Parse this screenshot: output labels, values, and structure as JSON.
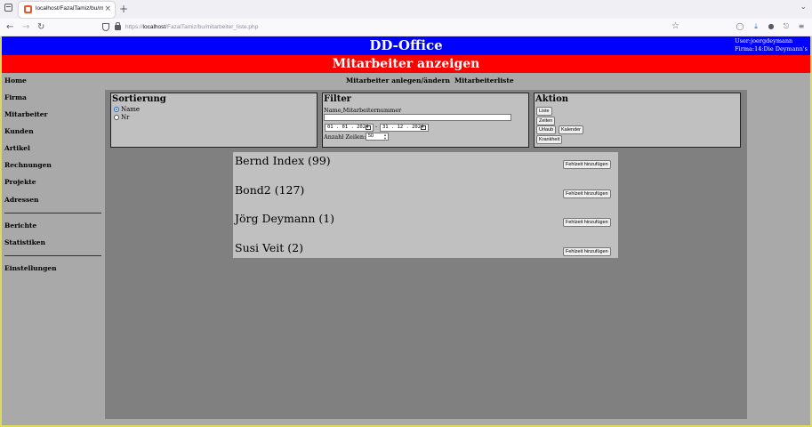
{
  "browser": {
    "tab_title": "localhost/FazalTamiz/bu/mitarbe",
    "new_tab": "+",
    "close": "×",
    "url_host": "localhost",
    "url_prefix": "https://",
    "url_path": "/FazalTamiz/bu/mitarbeiter_liste.php"
  },
  "app": {
    "title": "DD-Office",
    "user_line": "User:joergdeymann",
    "firma_line": "Firma:14:Die Deymann's",
    "page_title": "Mitarbeiter anzeigen"
  },
  "sidebar": {
    "items": [
      "Home",
      "Firma",
      "Mitarbeiter",
      "Kunden",
      "Artikel",
      "Rechnungen",
      "Projekte",
      "Adressen",
      "Berichte",
      "Statistiken",
      "Einstellungen"
    ]
  },
  "subnav": {
    "items": [
      "Mitarbeiter anlegen/ändern",
      "Mitarbeiterliste"
    ]
  },
  "sortierung": {
    "title": "Sortierung",
    "options": [
      "Name",
      "Nr"
    ],
    "selected": "Name"
  },
  "filter": {
    "title": "Filter",
    "name_label": "Name,Mitarbeiternummer",
    "name_value": "",
    "date_from": "01 . 01 . 2024",
    "date_sep": "-",
    "date_to": "31 . 12 . 2024",
    "rows_label": "Anzahl Zeilen:",
    "rows_value": "50"
  },
  "aktion": {
    "title": "Aktion",
    "buttons": [
      "Liste",
      "Zeiten",
      "Urlaub",
      "Kalender",
      "Krankheit"
    ]
  },
  "employees": [
    {
      "name": "Bernd Index (99)",
      "action": "Fehlzeit hinzufügen"
    },
    {
      "name": "Bond2 (127)",
      "action": "Fehlzeit hinzufügen"
    },
    {
      "name": "Jörg Deymann (1)",
      "action": "Fehlzeit hinzufügen"
    },
    {
      "name": "Susi Veit (2)",
      "action": "Fehlzeit hinzufügen"
    }
  ],
  "colors": {
    "header_blue": "#0000ff",
    "header_red": "#ff0000",
    "page_bg": "#a9a9a9",
    "main_bg": "#808080",
    "panel_bg": "#c0c0c0"
  }
}
